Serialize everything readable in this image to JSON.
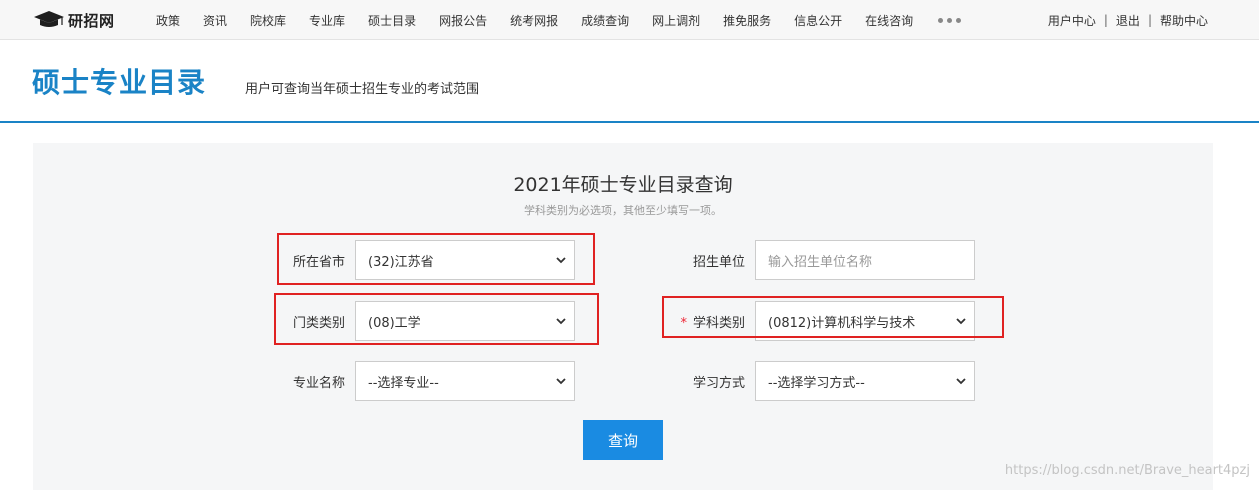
{
  "nav": {
    "logo_text": "研招网",
    "links": [
      "政策",
      "资讯",
      "院校库",
      "专业库",
      "硕士目录",
      "网报公告",
      "统考网报",
      "成绩查询",
      "网上调剂",
      "推免服务",
      "信息公开",
      "在线咨询"
    ],
    "user_links": [
      "用户中心",
      "退出",
      "帮助中心"
    ]
  },
  "header": {
    "title": "硕士专业目录",
    "subtitle": "用户可查询当年硕士招生专业的考试范围"
  },
  "form": {
    "title": "2021年硕士专业目录查询",
    "hint": "学科类别为必选项，其他至少填写一项。",
    "province": {
      "label": "所在省市",
      "value": "(32)江苏省"
    },
    "unit": {
      "label": "招生单位",
      "placeholder": "输入招生单位名称"
    },
    "category": {
      "label": "门类类别",
      "value": "(08)工学"
    },
    "discipline": {
      "label": "学科类别",
      "required_mark": "*",
      "value": "(0812)计算机科学与技术"
    },
    "major": {
      "label": "专业名称",
      "value": "--选择专业--"
    },
    "study_mode": {
      "label": "学习方式",
      "value": "--选择学习方式--"
    },
    "submit_label": "查询"
  },
  "watermark": "https://blog.csdn.net/Brave_heart4pzj",
  "colors": {
    "accent": "#1a83c6",
    "button": "#1a8be2",
    "highlight": "#e02222"
  }
}
